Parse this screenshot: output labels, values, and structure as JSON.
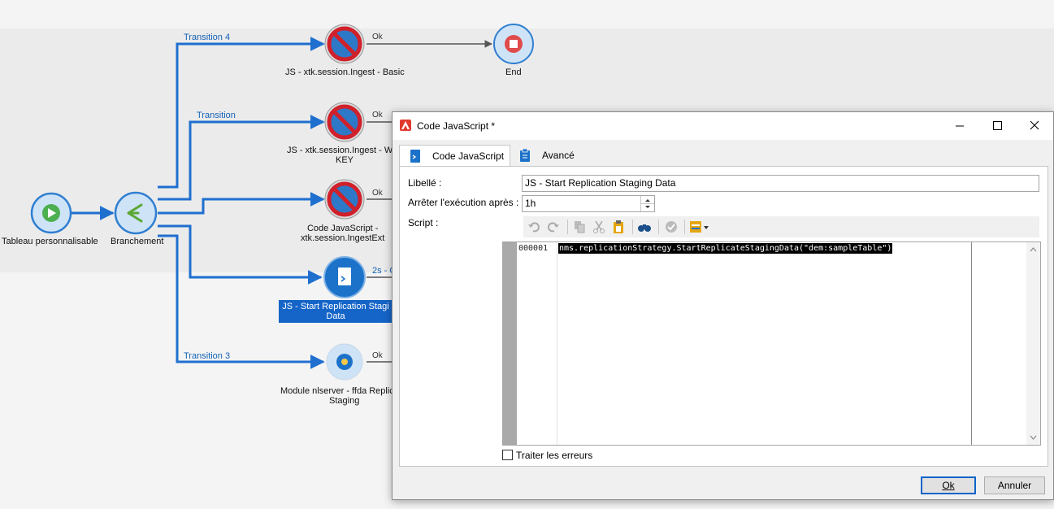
{
  "workflow": {
    "nodes": {
      "start": {
        "label": "Tableau personnalisable"
      },
      "fork": {
        "label": "Branchement"
      },
      "js_basic": {
        "label": "JS - xtk.session.Ingest - Basic"
      },
      "end": {
        "label": "End"
      },
      "js_key": {
        "label_line1": "JS - xtk.session.Ingest - W",
        "label_line2": "KEY"
      },
      "js_ext": {
        "label_line1": "Code JavaScript -",
        "label_line2": "xtk.session.IngestExt"
      },
      "js_replication": {
        "label_line1": "JS - Start Replication Stagi",
        "label_line2": "Data"
      },
      "module": {
        "label_line1": "Module nlserver  - ffda Replic",
        "label_line2": "Staging"
      }
    },
    "transitions": {
      "t4": "Transition 4",
      "t1": "Transition",
      "t3": "Transition 3",
      "ok1": "Ok",
      "ok2": "Ok",
      "ok3": "Ok",
      "ok5": "Ok",
      "delay": "2s - O"
    }
  },
  "dialog": {
    "title": "Code JavaScript *",
    "tabs": [
      {
        "label": "Code JavaScript",
        "icon": "js-file-icon",
        "active": true
      },
      {
        "label": "Avancé",
        "icon": "clipboard-icon",
        "active": false
      }
    ],
    "fields": {
      "libelle_label": "Libellé :",
      "libelle_value": "JS - Start Replication Staging Data",
      "timeout_label": "Arrêter l'exécution après :",
      "timeout_value": "1h",
      "script_label": "Script :"
    },
    "editor": {
      "line_number": "000001",
      "code": "nms.replicationStrategy.StartReplicateStagingData(\"dem:sampleTable\")"
    },
    "checkbox_label": "Traiter les erreurs",
    "buttons": {
      "ok": "Ok",
      "cancel": "Annuler"
    },
    "colors": {
      "accent": "#0a64c8",
      "selection": "#1565c8",
      "link": "#1f6fcf"
    }
  }
}
